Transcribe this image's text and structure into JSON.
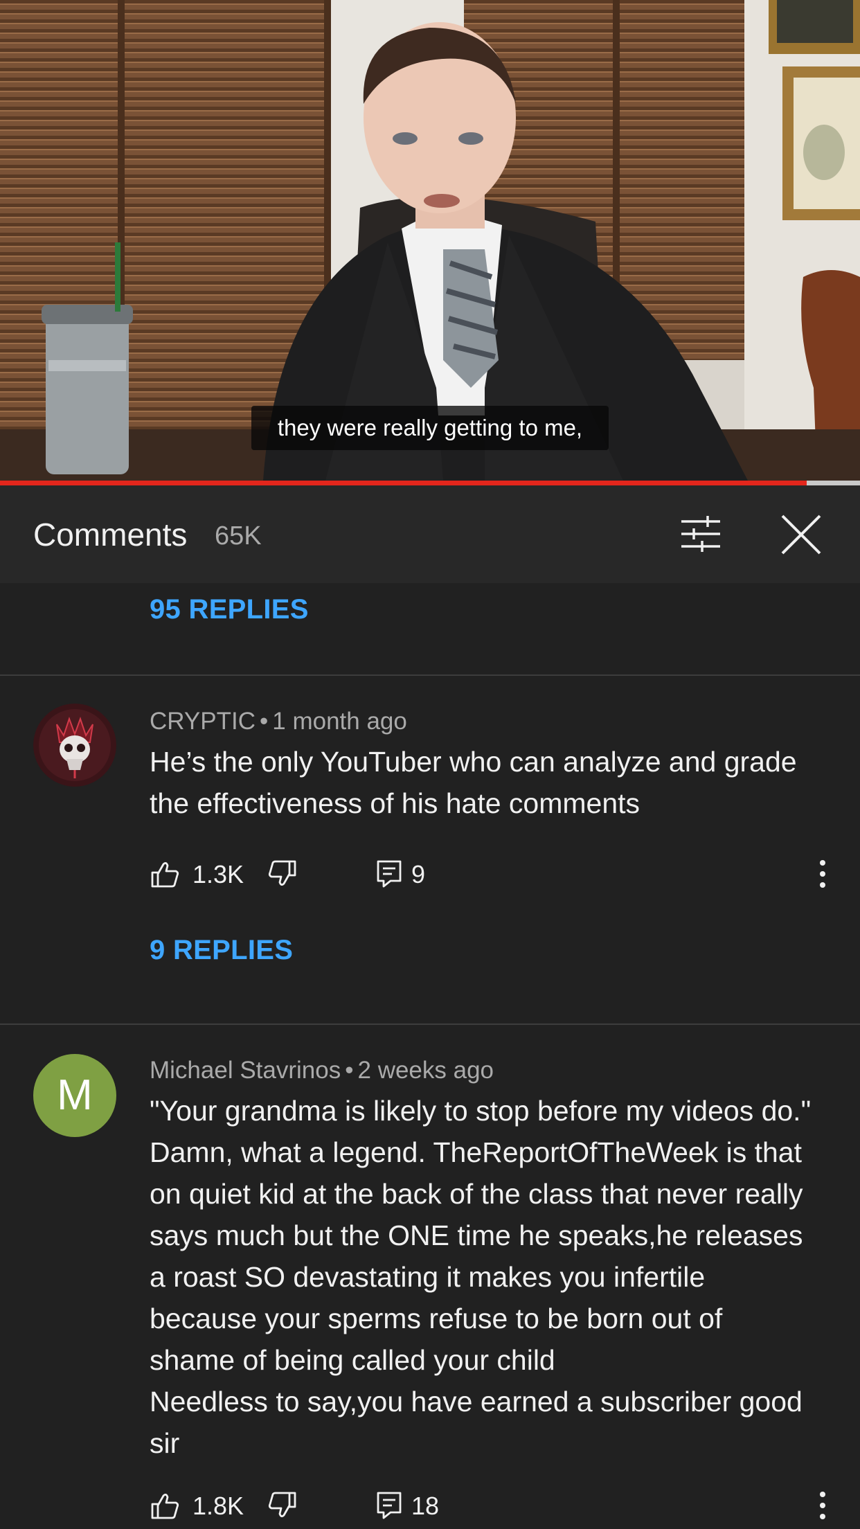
{
  "video": {
    "caption": "they were really getting to me,",
    "progress": 0.938
  },
  "comments_header": {
    "title": "Comments",
    "count": "65K",
    "filter_icon": "sort-sliders-icon",
    "close_icon": "close-icon"
  },
  "list": {
    "top_replies_link": "95 REPLIES",
    "comments": [
      {
        "author": "CRYPTIC",
        "time": "1 month ago",
        "avatar_type": "image",
        "text_lines": [
          "He’s the only YouTuber who can analyze and grade",
          "the effectiveness of his hate comments"
        ],
        "likes": "1.3K",
        "reply_count": "9",
        "replies_link": "9 REPLIES"
      },
      {
        "author": "Michael Stavrinos",
        "time": "2 weeks ago",
        "avatar_letter": "M",
        "avatar_color": "#7fa043",
        "text_lines": [
          "\"Your grandma is likely to stop before my videos do.\"",
          "Damn, what a legend. TheReportOfTheWeek is that",
          "on quiet kid at the back of the class that never really",
          "says much but the ONE time he speaks,he releases",
          "a roast SO devastating it makes you infertile",
          "because your sperms refuse to be born out of",
          "shame of being called your child",
          "Needless to say,you have earned a subscriber good",
          "sir"
        ],
        "likes": "1.8K",
        "reply_count": "18"
      }
    ],
    "separator": "•"
  },
  "colors": {
    "background": "#212121",
    "header_bg": "#282828",
    "link_blue": "#3ea6ff",
    "progress_red": "#e3261c"
  }
}
